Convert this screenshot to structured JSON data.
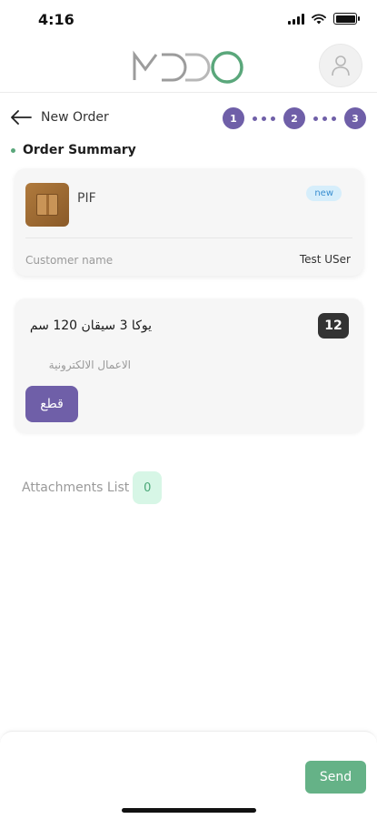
{
  "status_bar": {
    "time": "4:16"
  },
  "header": {
    "logo_icon": "mdo-logo",
    "avatar_icon": "user-icon"
  },
  "nav": {
    "back_icon": "arrow-left-icon",
    "title": "New Order",
    "steps": [
      "1",
      "2",
      "3"
    ]
  },
  "section": {
    "title": "Order Summary"
  },
  "summary_card": {
    "product_name": "PIF",
    "status_badge": "new",
    "customer_label": "Customer name",
    "customer_value": "Test USer"
  },
  "item_card": {
    "title": "يوكا 3 سيقان 120 سم",
    "quantity": "12",
    "category": "الاعمال الالكترونية",
    "action_label": "قطع"
  },
  "attachments": {
    "label": "Attachments List",
    "count": "0"
  },
  "footer": {
    "send_label": "Send"
  },
  "colors": {
    "primary_purple": "#6f5fa8",
    "accent_green": "#65b287",
    "badge_blue_bg": "#d6eefb",
    "badge_blue_text": "#3a8fd0"
  }
}
